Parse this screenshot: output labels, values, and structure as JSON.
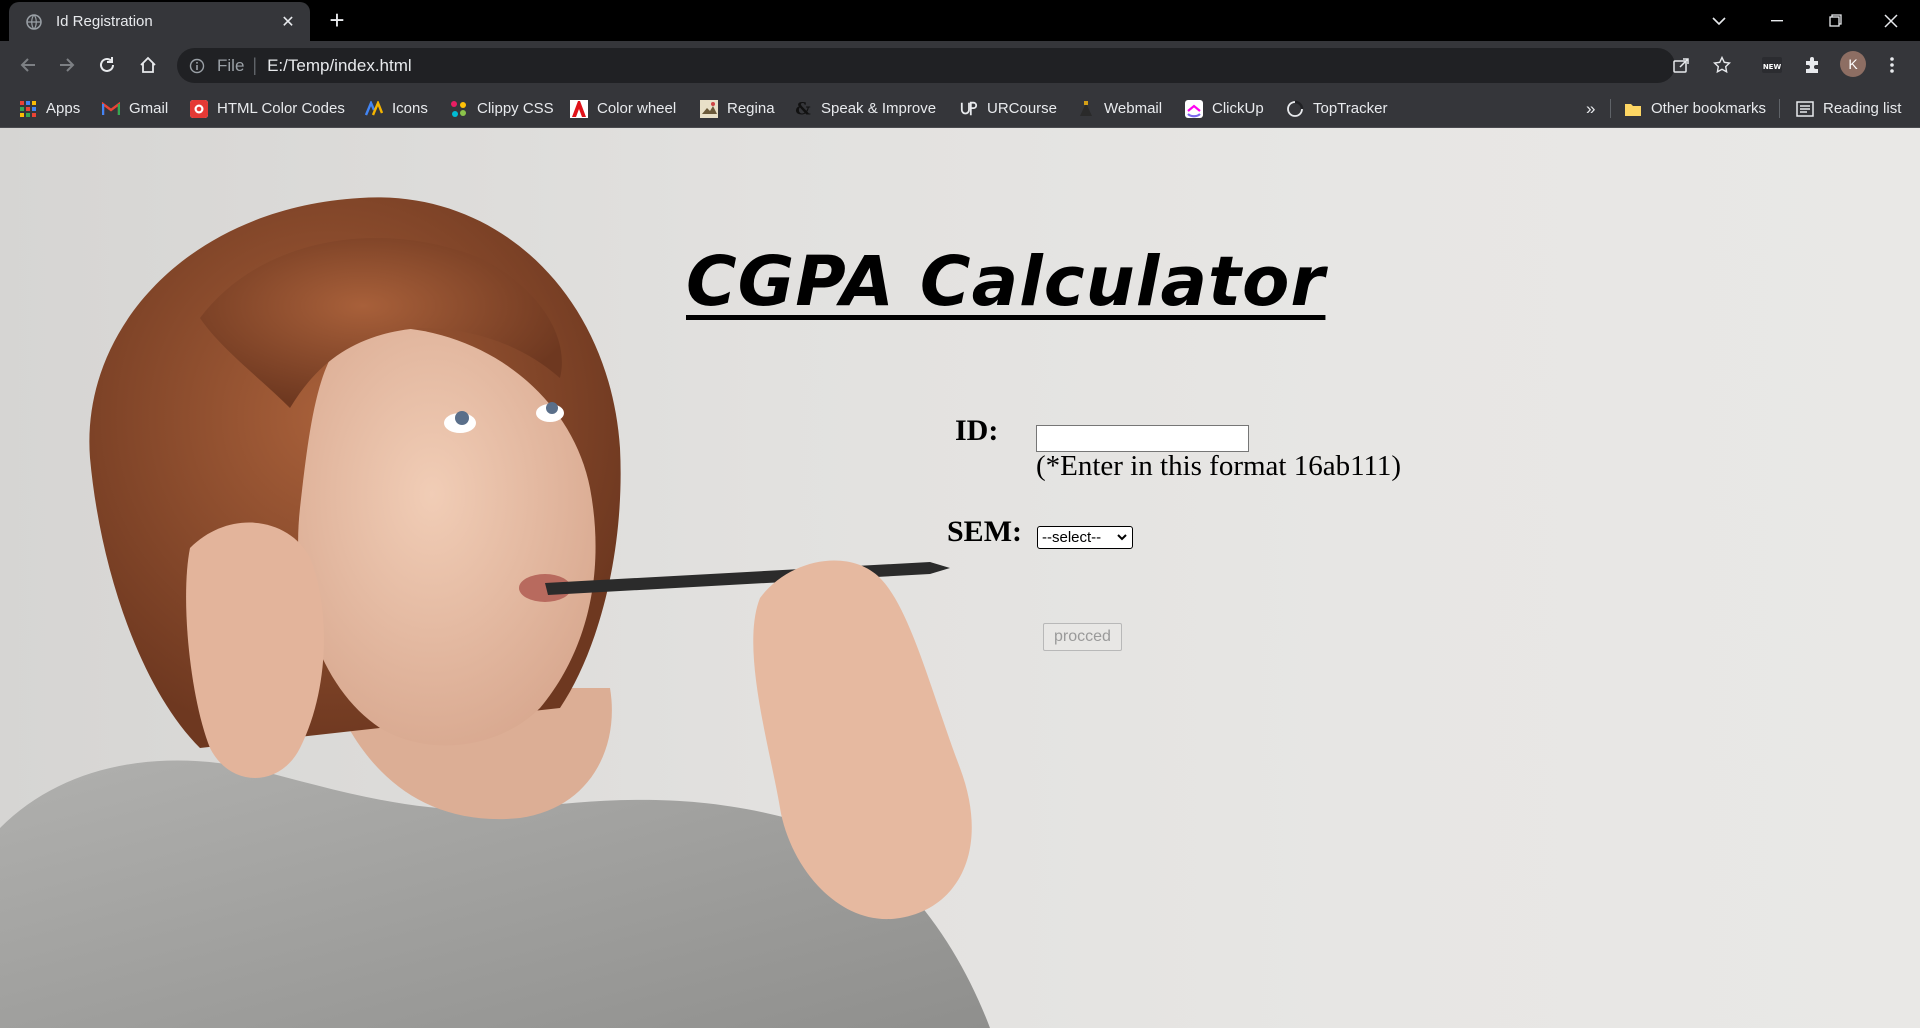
{
  "browser": {
    "tab_title": "Id Registration",
    "tab_close": "✕",
    "new_tab": "+",
    "url_scheme": "File",
    "url": "E:/Temp/index.html",
    "avatar_letter": "K"
  },
  "bookmarks": {
    "items": [
      {
        "label": "Apps",
        "icon": "apps-grid-icon"
      },
      {
        "label": "Gmail",
        "icon": "gmail-icon"
      },
      {
        "label": "HTML Color Codes",
        "icon": "html-color-codes-icon"
      },
      {
        "label": "Icons",
        "icon": "icons-icon"
      },
      {
        "label": "Clippy CSS",
        "icon": "clippy-css-icon"
      },
      {
        "label": "Color wheel",
        "icon": "adobe-icon"
      },
      {
        "label": "Regina",
        "icon": "regina-icon"
      },
      {
        "label": "Speak & Improve",
        "icon": "speak-improve-icon"
      },
      {
        "label": "URCourse",
        "icon": "urcourse-icon"
      },
      {
        "label": "Webmail",
        "icon": "webmail-icon"
      },
      {
        "label": "ClickUp",
        "icon": "clickup-icon"
      },
      {
        "label": "TopTracker",
        "icon": "toptracker-icon"
      }
    ],
    "overflow": "»",
    "other_bookmarks": "Other bookmarks",
    "reading_list": "Reading list"
  },
  "page": {
    "title": "CGPA Calculator",
    "id_label": "ID:",
    "id_value": "",
    "id_hint": "(*Enter in this format 16ab111)",
    "sem_label": "SEM:",
    "sem_selected": "--select--",
    "proceed_label": "procced"
  }
}
